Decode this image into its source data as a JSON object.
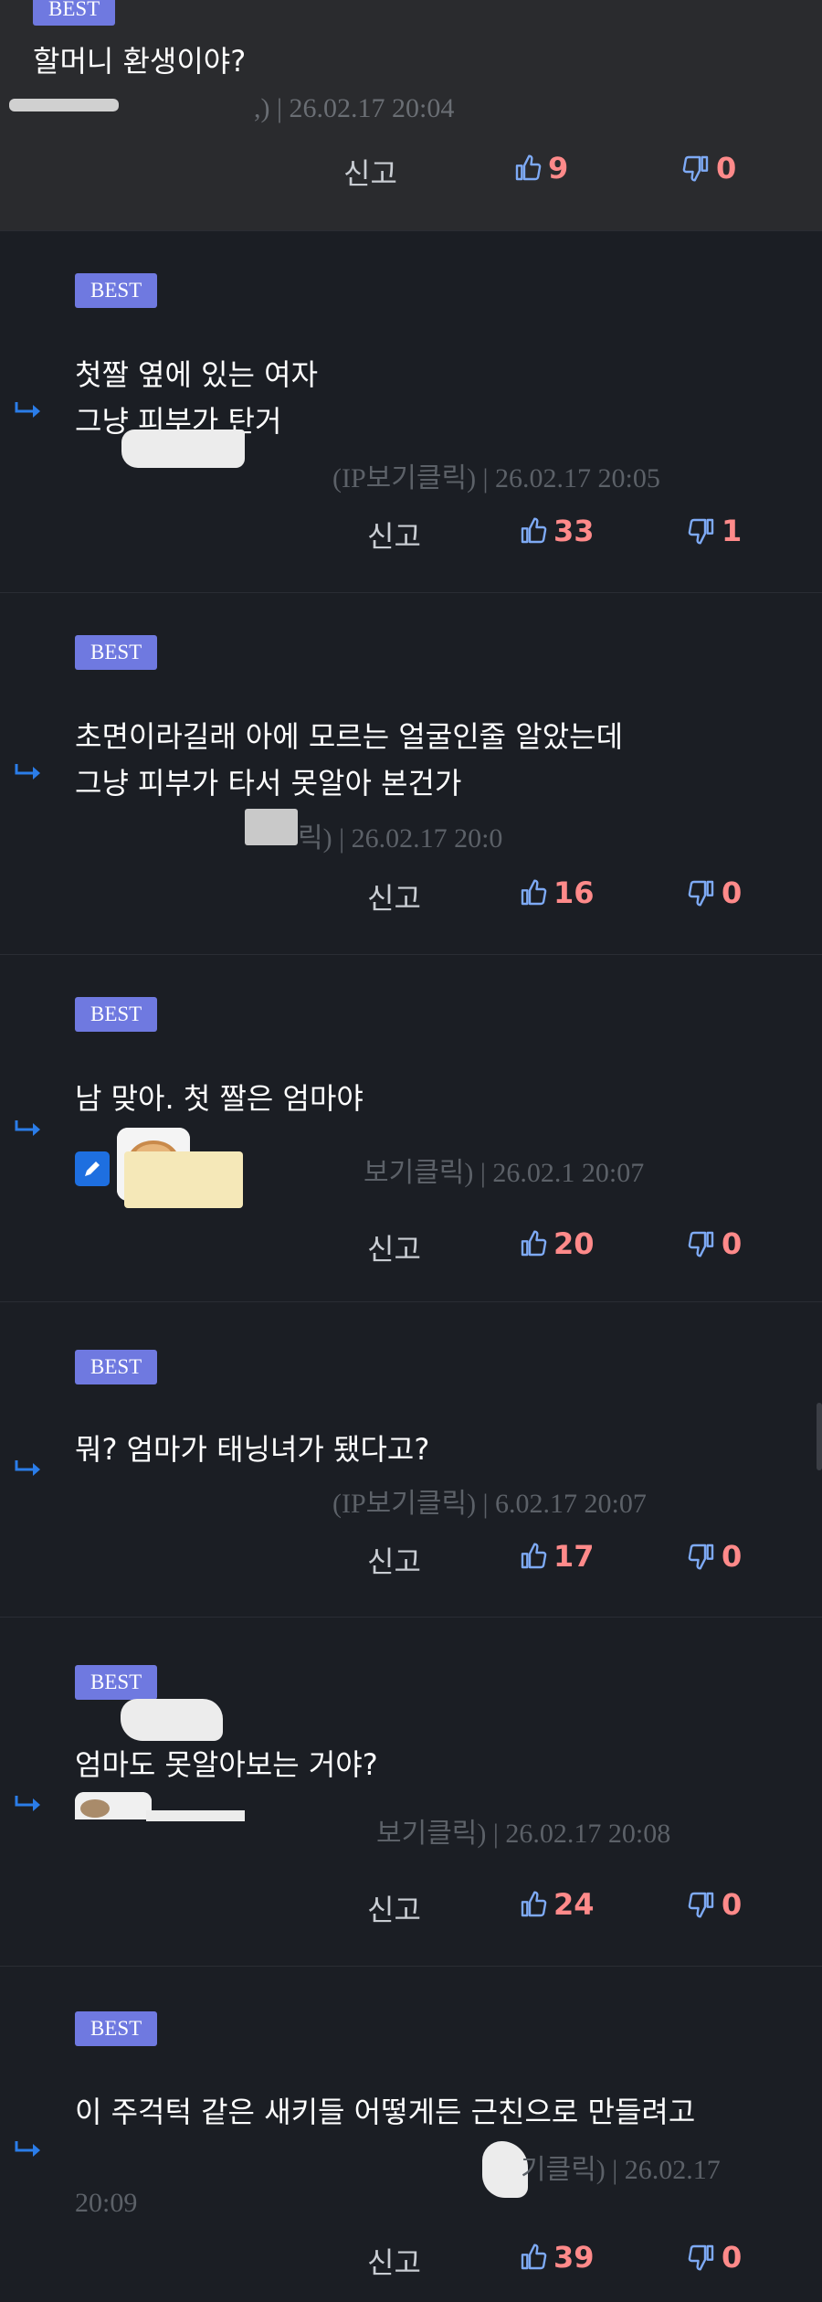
{
  "colors": {
    "background": "#1b1e24",
    "top_comment_bg": "#2a2b2e",
    "best_badge": "#6f79e0",
    "vote_count": "#ff8a8a",
    "reply_arrow": "#2b7de9"
  },
  "comments": [
    {
      "badge": "BEST",
      "lines": [
        "할머니 환생이야?"
      ],
      "meta": ",) | 26.02.17 20:04",
      "report": "신고",
      "up": "9",
      "down": "0"
    },
    {
      "badge": "BEST",
      "lines": [
        "첫짤 옆에 있는 여자",
        "그냥 피부가 탄거"
      ],
      "meta": "(IP보기클릭) | 26.02.17 20:05",
      "report": "신고",
      "up": "33",
      "down": "1"
    },
    {
      "badge": "BEST",
      "lines": [
        "초면이라길래 아에 모르는 얼굴인줄 알았는데",
        "그냥 피부가 타서 못알아 본건가"
      ],
      "meta": "릭) | 26.02.17 20:0",
      "report": "신고",
      "up": "16",
      "down": "0"
    },
    {
      "badge": "BEST",
      "lines": [
        "남 맞아. 첫 짤은 엄마야"
      ],
      "meta": "보기클릭) | 26.02.1   20:07",
      "report": "신고",
      "up": "20",
      "down": "0"
    },
    {
      "badge": "BEST",
      "lines": [
        "뭐? 엄마가 태닝녀가 됐다고?"
      ],
      "meta": "(IP보기클릭) |    6.02.17 20:07",
      "report": "신고",
      "up": "17",
      "down": "0"
    },
    {
      "badge": "BEST",
      "lines": [
        "엄마도 못알아보는 거야?"
      ],
      "meta": "보기클릭) | 26.02.17 20:08",
      "report": "신고",
      "up": "24",
      "down": "0"
    },
    {
      "badge": "BEST",
      "lines": [
        "이 주걱턱 같은 새키들 어떻게든 근친으로 만들려고"
      ],
      "meta": "기클릭) | 26.02.17",
      "meta2": "20:09",
      "report": "신고",
      "up": "39",
      "down": "0"
    }
  ]
}
